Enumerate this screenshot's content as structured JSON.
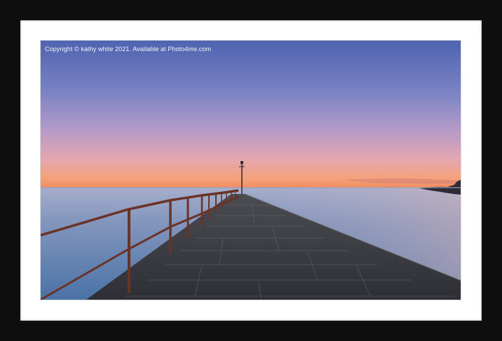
{
  "watermark": {
    "text": "Copyright © kathy white 2021. Available at Photo4me.com"
  },
  "colors": {
    "frame": "#0e0e0e",
    "mount": "#ffffff",
    "sky_top": "#4f63b0",
    "sky_horizon_glow": "#f39a70",
    "sea": "#7d8fb8",
    "pier_stone": "#3a3b40",
    "railing": "#6b3226"
  }
}
